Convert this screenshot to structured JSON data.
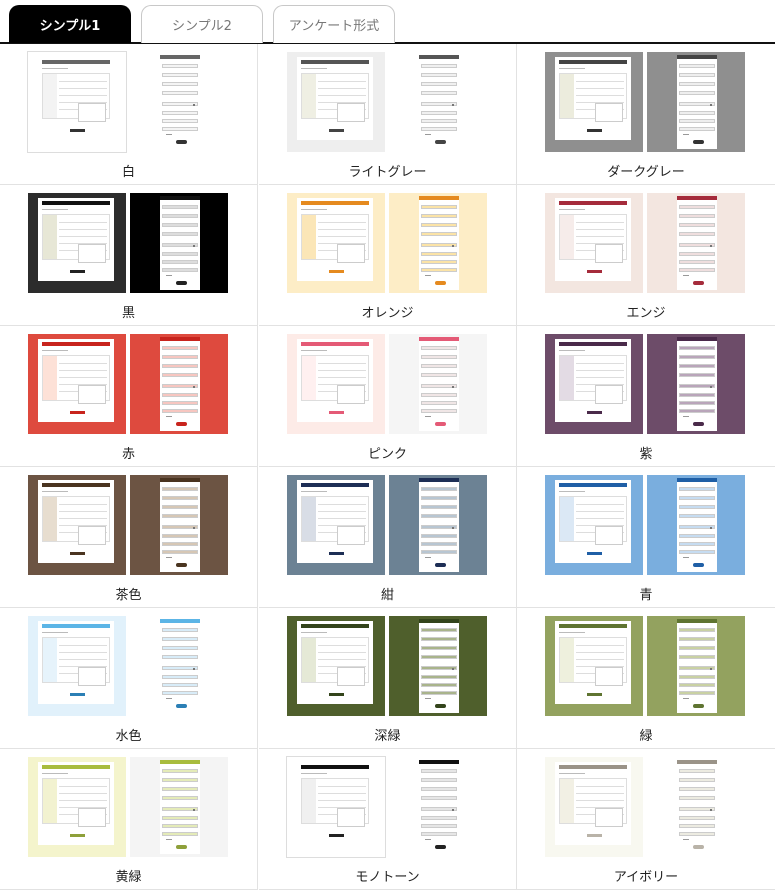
{
  "tabs": [
    {
      "label": "シンプル1"
    },
    {
      "label": "シンプル2"
    },
    {
      "label": "アンケート形式"
    }
  ],
  "themes": [
    {
      "label": "白",
      "pc_bg": "#ffffff",
      "pc_border": true,
      "sp_bg": "#ffffff",
      "accent": "#666666",
      "side": "#f3f3f3",
      "field_bg": "#f4f4f4",
      "btn": "#333333"
    },
    {
      "label": "ライトグレー",
      "pc_bg": "#eeeeee",
      "pc_border": false,
      "sp_bg": "#ffffff",
      "accent": "#555555",
      "side": "#efefe3",
      "field_bg": "#f0f0f0",
      "btn": "#444444"
    },
    {
      "label": "ダークグレー",
      "pc_bg": "#8f8f8f",
      "pc_border": false,
      "sp_bg": "#8f8f8f",
      "accent": "#444444",
      "side": "#ececdd",
      "field_bg": "#eeeeee",
      "btn": "#333333"
    },
    {
      "label": "黒",
      "pc_bg": "#2c2c2c",
      "pc_border": false,
      "sp_bg": "#000000",
      "accent": "#111111",
      "side": "#e7e7d6",
      "field_bg": "#dddddd",
      "btn": "#222222"
    },
    {
      "label": "オレンジ",
      "pc_bg": "#fdedc6",
      "pc_border": false,
      "sp_bg": "#fdedc6",
      "accent": "#e58a1f",
      "side": "#fbe6b7",
      "field_bg": "#fbe3a6",
      "btn": "#e58a1f"
    },
    {
      "label": "エンジ",
      "pc_bg": "#f3e6e0",
      "pc_border": false,
      "sp_bg": "#f3e6e0",
      "accent": "#a52b3b",
      "side": "#f6ecea",
      "field_bg": "#efdede",
      "btn": "#a52b3b"
    },
    {
      "label": "赤",
      "pc_bg": "#de4a3e",
      "pc_border": false,
      "sp_bg": "#de4a3e",
      "accent": "#c8241d",
      "side": "#fde1d7",
      "field_bg": "#f7c6c0",
      "btn": "#c8241d"
    },
    {
      "label": "ピンク",
      "pc_bg": "#fdebe7",
      "pc_border": false,
      "sp_bg": "#f5f5f5",
      "accent": "#e45a76",
      "side": "#fff0f0",
      "field_bg": "#f0e6e6",
      "btn": "#e45a76"
    },
    {
      "label": "紫",
      "pc_bg": "#6d4c69",
      "pc_border": false,
      "sp_bg": "#6d4c69",
      "accent": "#4a2a4a",
      "side": "#e3dbe4",
      "field_bg": "#b9a5ba",
      "btn": "#4a2a4a"
    },
    {
      "label": "茶色",
      "pc_bg": "#6c5443",
      "pc_border": false,
      "sp_bg": "#6c5443",
      "accent": "#4a3420",
      "side": "#e7ddcf",
      "field_bg": "#d6c7b5",
      "btn": "#4a3420"
    },
    {
      "label": "紺",
      "pc_bg": "#6c8294",
      "pc_border": false,
      "sp_bg": "#6c8294",
      "accent": "#1d2e55",
      "side": "#d8dde6",
      "field_bg": "#b8c6d2",
      "btn": "#1d2e55"
    },
    {
      "label": "青",
      "pc_bg": "#7aaede",
      "pc_border": false,
      "sp_bg": "#7aaede",
      "accent": "#1f5fa6",
      "side": "#dbe8f5",
      "field_bg": "#c6dcf1",
      "btn": "#1f5fa6"
    },
    {
      "label": "水色",
      "pc_bg": "#e1f1fb",
      "pc_border": false,
      "sp_bg": "#ffffff",
      "accent": "#5cb5e6",
      "side": "#e6f3fb",
      "field_bg": "#d8ecf8",
      "btn": "#2b7fb5"
    },
    {
      "label": "深緑",
      "pc_bg": "#4f5f2c",
      "pc_border": false,
      "sp_bg": "#4f5f2c",
      "accent": "#33441b",
      "side": "#e5e9d6",
      "field_bg": "#a9b48b",
      "btn": "#33441b"
    },
    {
      "label": "緑",
      "pc_bg": "#93a25f",
      "pc_border": false,
      "sp_bg": "#93a25f",
      "accent": "#5f7431",
      "side": "#eef0dd",
      "field_bg": "#c9d1a3",
      "btn": "#5f7431"
    },
    {
      "label": "黄緑",
      "pc_bg": "#f4f4cc",
      "pc_border": false,
      "sp_bg": "#f4f4f4",
      "accent": "#a8bc3e",
      "side": "#f2f2d0",
      "field_bg": "#e4ebb8",
      "btn": "#8ea03a"
    },
    {
      "label": "モノトーン",
      "pc_bg": "#ffffff",
      "pc_border": true,
      "sp_bg": "#ffffff",
      "accent": "#111111",
      "side": "#f0f0f0",
      "field_bg": "#e6e6e6",
      "btn": "#222222"
    },
    {
      "label": "アイボリー",
      "pc_bg": "#f8f8f0",
      "pc_border": false,
      "sp_bg": "#ffffff",
      "accent": "#9a9388",
      "side": "#f2f0e4",
      "field_bg": "#ecebe1",
      "btn": "#b9b3a8"
    }
  ]
}
